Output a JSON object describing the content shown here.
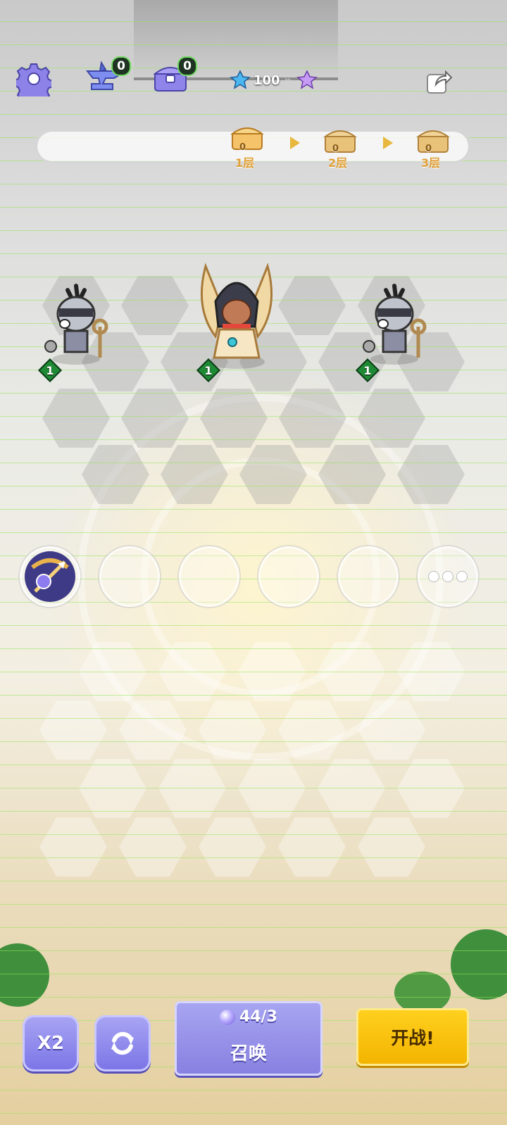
{
  "topbar": {
    "settings_icon": "gear-icon",
    "anvil_count": "0",
    "chest_count": "0",
    "star_currency": "100"
  },
  "progress": {
    "floors": [
      {
        "label": "1层",
        "reward_label": "0"
      },
      {
        "label": "2层",
        "reward_label": "0"
      },
      {
        "label": "3层",
        "reward_label": "0"
      }
    ]
  },
  "board": {
    "units": [
      {
        "name": "skeleton-mace-unit",
        "level": "1"
      },
      {
        "name": "pharaoh-hero-unit",
        "level": "1"
      },
      {
        "name": "skeleton-mace-unit",
        "level": "1"
      }
    ]
  },
  "skills": {
    "equipped": [
      {
        "icon": "crossbow-skill-icon"
      }
    ],
    "empty_slots": 4
  },
  "bottom": {
    "speed_label": "X2",
    "summon_cost": "44/3",
    "summon_label": "召唤",
    "fight_label": "开战!"
  },
  "colors": {
    "accent_purple": "#8780e0",
    "fight_yellow": "#f3b300",
    "level_green": "#1f8a35",
    "reward_gold": "#e0a035"
  }
}
